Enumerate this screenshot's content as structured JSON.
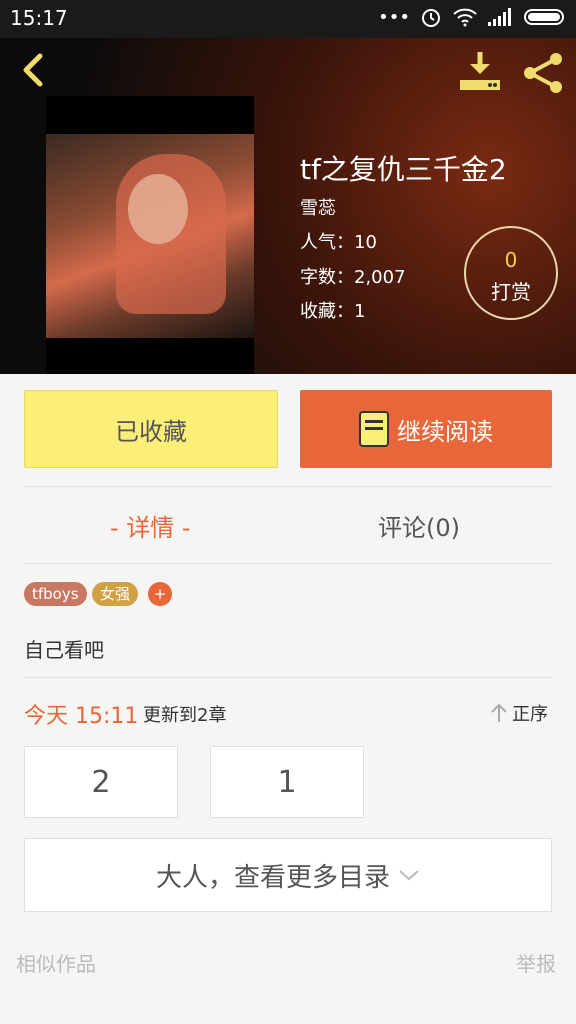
{
  "status_bar": {
    "time": "15:17",
    "dots": "•••"
  },
  "book": {
    "title": "tf之复仇三千金2",
    "author": "雪蕊",
    "popularity": "人气：10",
    "word_count": "字数：2,007",
    "favorites": "收藏：1"
  },
  "reward": {
    "count": "0",
    "label": "打赏"
  },
  "actions": {
    "favorited_label": "已收藏",
    "continue_label": "继续阅读"
  },
  "tabs": {
    "detail": "- 详情 -",
    "comments": "评论(0)"
  },
  "tags": [
    {
      "label": "tfboys",
      "color": "#c87760"
    },
    {
      "label": "女强",
      "color": "#d1a145"
    },
    {
      "label": "+",
      "color": "#e8673a"
    }
  ],
  "description": "自己看吧",
  "update": {
    "time": "今天 15:11",
    "text": "更新到2章",
    "sort_label": "正序"
  },
  "chapters": [
    "2",
    "1"
  ],
  "more_catalog": "大人，查看更多目录",
  "footer": {
    "similar": "相似作品",
    "report": "举报"
  },
  "colors": {
    "accent": "#e8673a",
    "fav_button": "#fcef79",
    "icon_yellow": "#f0dc6a"
  }
}
